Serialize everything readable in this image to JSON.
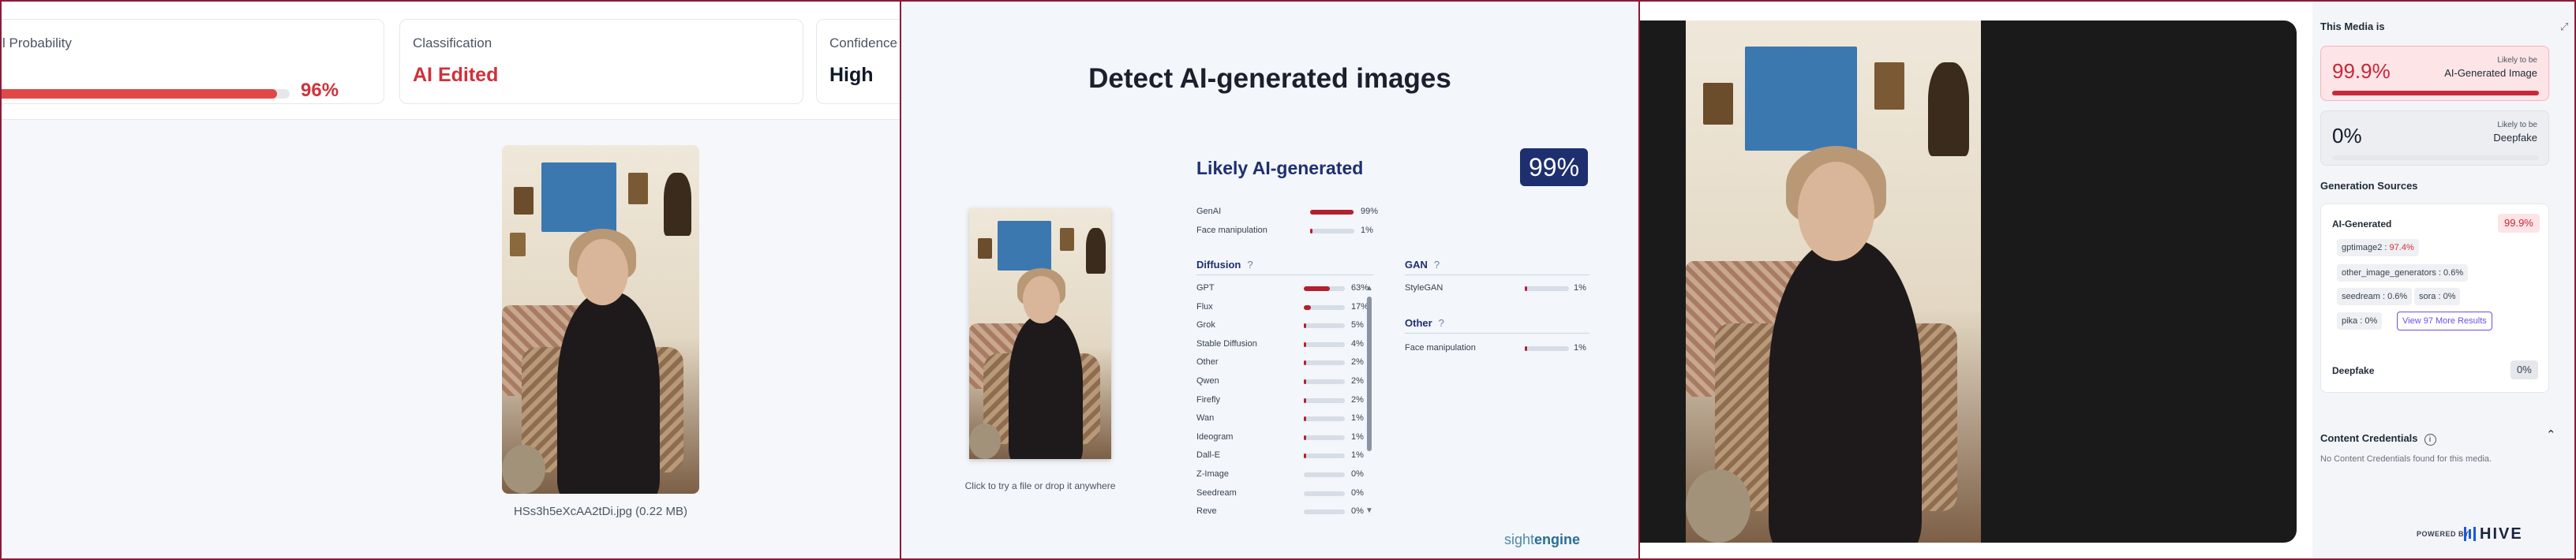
{
  "panel1": {
    "cards": {
      "probability_label": "l Probability",
      "probability_value": "96%",
      "probability_fraction": 0.96,
      "classification_label": "Classification",
      "classification_value": "AI Edited",
      "confidence_label": "Confidence",
      "confidence_value": "High"
    },
    "filename": "HSs3h5eXcAA2tDi.jpg (0.22 MB)"
  },
  "panel2": {
    "title": "Detect AI-generated images",
    "hint": "Click to try a file or drop it anywhere",
    "likely": "Likely AI-generated",
    "score": "99%",
    "summary": [
      {
        "name": "GenAI",
        "pct": "99%",
        "value": 0.99
      },
      {
        "name": "Face manipulation",
        "pct": "1%",
        "value": 0.01
      }
    ],
    "diffusion_title": "Diffusion",
    "diffusion": [
      {
        "name": "GPT",
        "pct": "63%",
        "value": 0.63
      },
      {
        "name": "Flux",
        "pct": "17%",
        "value": 0.17
      },
      {
        "name": "Grok",
        "pct": "5%",
        "value": 0.05
      },
      {
        "name": "Stable Diffusion",
        "pct": "4%",
        "value": 0.04
      },
      {
        "name": "Other",
        "pct": "2%",
        "value": 0.02
      },
      {
        "name": "Qwen",
        "pct": "2%",
        "value": 0.02
      },
      {
        "name": "Firefly",
        "pct": "2%",
        "value": 0.02
      },
      {
        "name": "Wan",
        "pct": "1%",
        "value": 0.01
      },
      {
        "name": "Ideogram",
        "pct": "1%",
        "value": 0.01
      },
      {
        "name": "Dall-E",
        "pct": "1%",
        "value": 0.01
      },
      {
        "name": "Z-Image",
        "pct": "0%",
        "value": 0.0
      },
      {
        "name": "Seedream",
        "pct": "0%",
        "value": 0.0
      },
      {
        "name": "Reve",
        "pct": "0%",
        "value": 0.0
      }
    ],
    "gan_title": "GAN",
    "gan": [
      {
        "name": "StyleGAN",
        "pct": "1%",
        "value": 0.01
      }
    ],
    "other_title": "Other",
    "other": [
      {
        "name": "Face manipulation",
        "pct": "1%",
        "value": 0.01
      }
    ],
    "help_glyph": "?",
    "brand_a": "sight",
    "brand_b": "engine"
  },
  "panel3": {
    "media_title": "This Media is",
    "ai_card": {
      "value": "99.9%",
      "line1": "Likely to be",
      "line2": "AI-Generated Image",
      "fraction": 0.999
    },
    "deepfake_card": {
      "value": "0%",
      "line1": "Likely to be",
      "line2": "Deepfake",
      "fraction": 0.0
    },
    "sources_title": "Generation Sources",
    "ai_generated_label": "AI-Generated",
    "ai_generated_value": "99.9%",
    "chips": [
      {
        "name": "gptimage2 :",
        "value": "97.4%"
      },
      {
        "name": "other_image_generators :",
        "value": "0.6%"
      },
      {
        "name": "seedream :",
        "value": "0.6%"
      },
      {
        "name": "sora :",
        "value": "0%"
      },
      {
        "name": "pika :",
        "value": "0%"
      }
    ],
    "more_button": "View 97 More Results",
    "deepfake_label": "Deepfake",
    "deepfake_value": "0%",
    "credentials_title": "Content Credentials",
    "credentials_info": "i",
    "credentials_text": "No Content Credentials found for this media.",
    "powered_by": "POWERED BY",
    "hive": "HIVE",
    "colors": {
      "accent_red": "#d0313a",
      "navy": "#1e2f6f",
      "purple": "#6d4ee0",
      "hive_blue": "#1a5adb"
    }
  }
}
